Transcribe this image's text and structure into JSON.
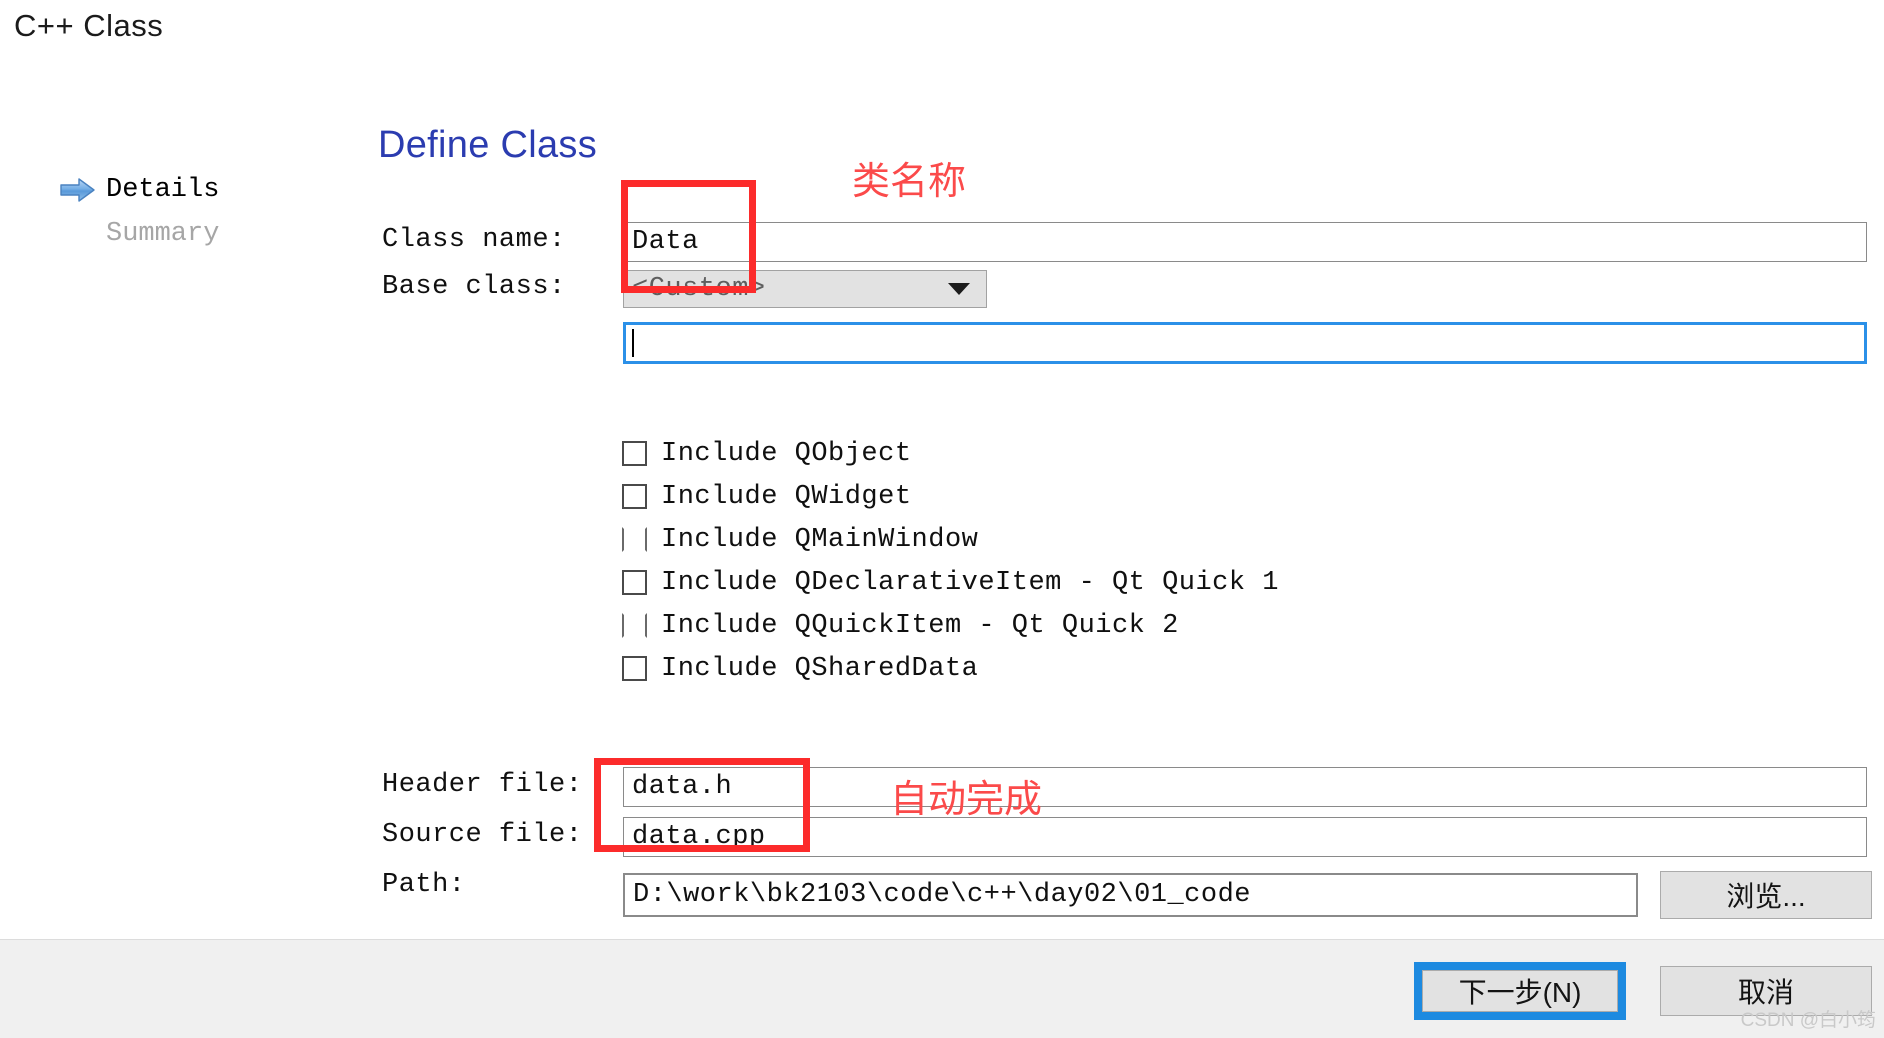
{
  "window": {
    "title": "C++ Class"
  },
  "steps": {
    "items": [
      {
        "label": "Details",
        "state": "active",
        "icon": "right-arrow-icon"
      },
      {
        "label": "Summary",
        "state": "inactive",
        "icon": "none"
      }
    ]
  },
  "form": {
    "heading": "Define Class",
    "class_name": {
      "label": "Class name:",
      "value": "Data"
    },
    "base_class": {
      "label": "Base class:",
      "value": "<Custom>",
      "arrow_icon": "chevron-down-icon"
    },
    "custom_base_class": {
      "value": "",
      "placeholder": ""
    },
    "includes": [
      {
        "label": "Include QObject",
        "checked": false,
        "enabled": true
      },
      {
        "label": "Include QWidget",
        "checked": false,
        "enabled": true
      },
      {
        "label": "Include QMainWindow",
        "checked": false,
        "enabled": false
      },
      {
        "label": "Include QDeclarativeItem - Qt Quick 1",
        "checked": false,
        "enabled": true
      },
      {
        "label": "Include QQuickItem - Qt Quick 2",
        "checked": false,
        "enabled": false
      },
      {
        "label": "Include QSharedData",
        "checked": false,
        "enabled": true
      }
    ],
    "header_file": {
      "label": "Header file:",
      "value": "data.h"
    },
    "source_file": {
      "label": "Source file:",
      "value": "data.cpp"
    },
    "path": {
      "label": "Path:",
      "value": "D:\\work\\bk2103\\code\\c++\\day02\\01_code"
    },
    "browse_button": "浏览..."
  },
  "footer": {
    "next_button": "下一步(N)",
    "cancel_button": "取消"
  },
  "annotations": [
    {
      "name": "class-name-annotation",
      "text": "类名称"
    },
    {
      "name": "auto-complete-annotation",
      "text": "自动完成"
    }
  ],
  "watermark": "CSDN @白小筠",
  "colors": {
    "heading_blue": "#2b3cb0",
    "annotation_red": "#fb4a4a",
    "focus_blue": "#1d8ae0"
  }
}
